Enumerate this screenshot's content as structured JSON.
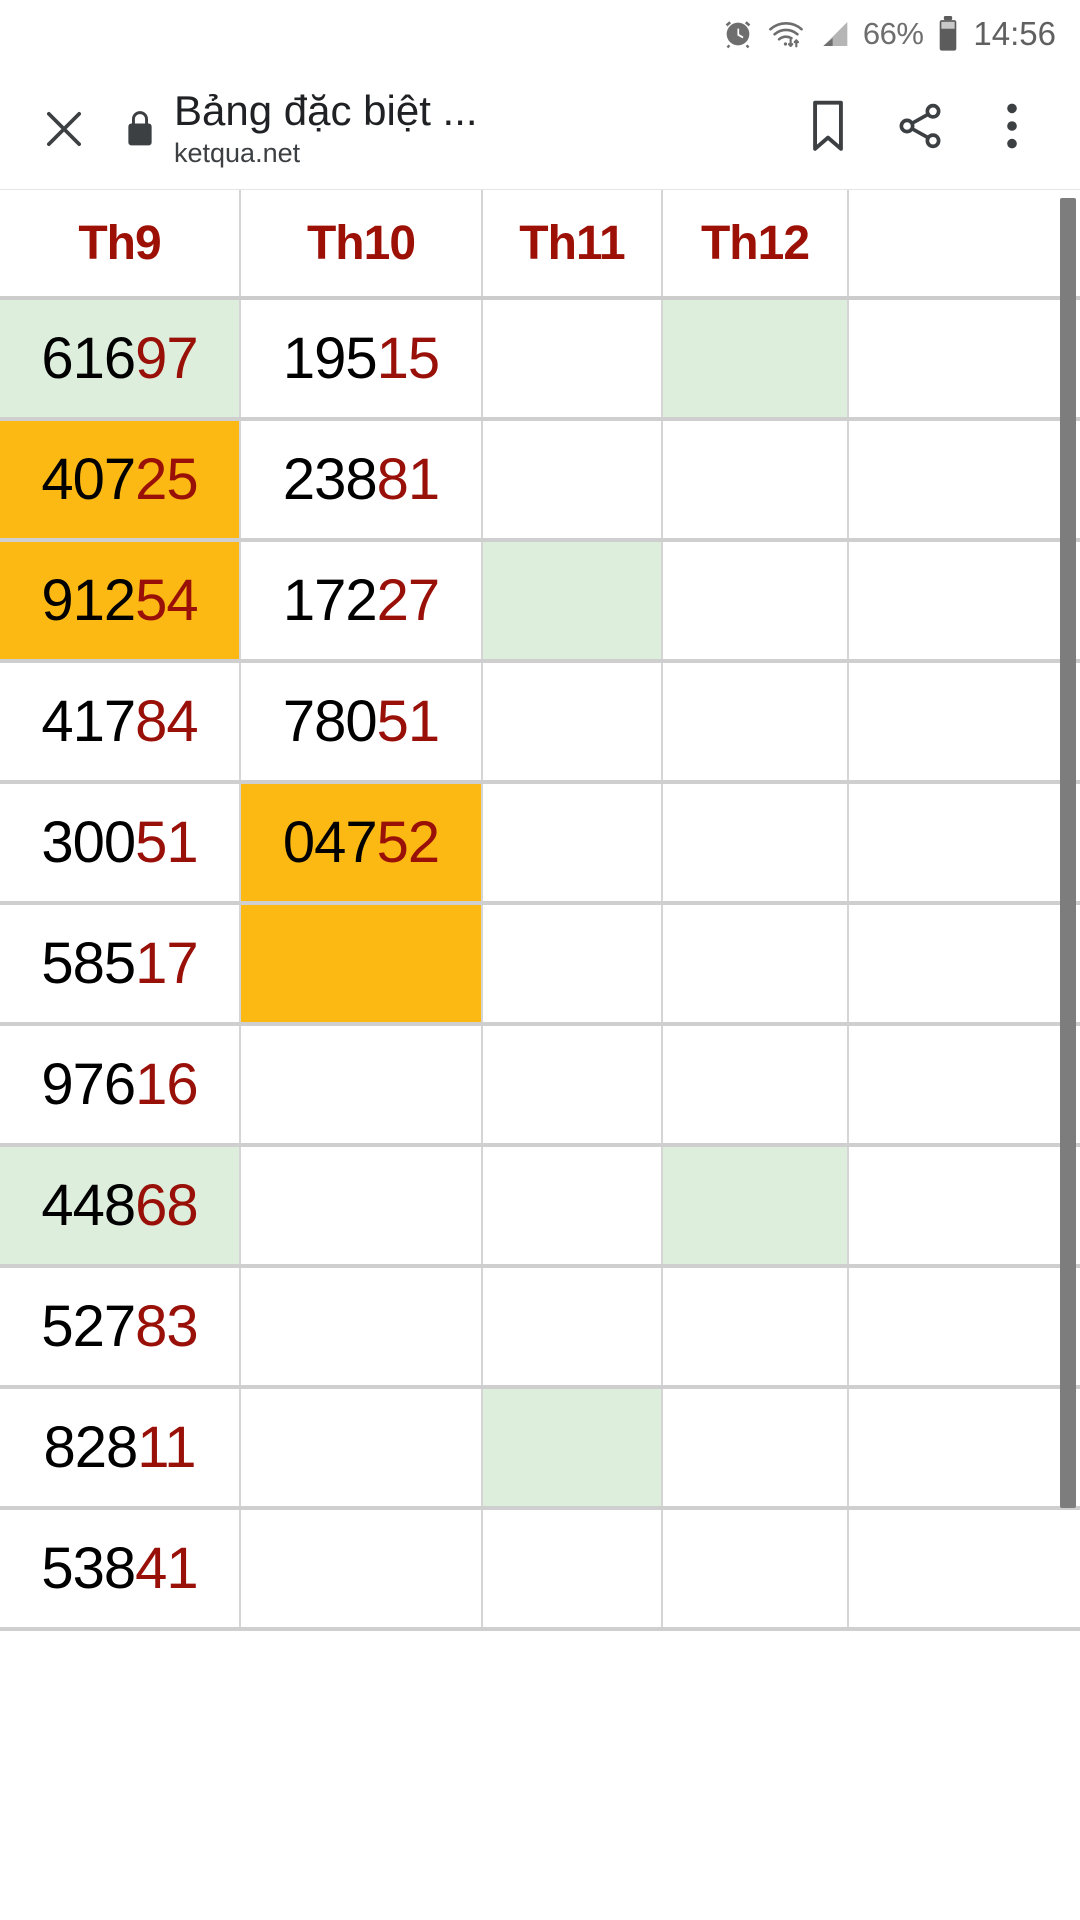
{
  "status_bar": {
    "alarm_icon": "alarm-icon",
    "wifi_icon": "wifi-icon",
    "signal_icon": "cellular-signal-icon",
    "battery_percent": "66%",
    "battery_icon": "battery-icon",
    "clock": "14:56"
  },
  "browser_bar": {
    "close_icon": "close-icon",
    "lock_icon": "lock-icon",
    "title": "Bảng đặc biệt ...",
    "url": "ketqua.net",
    "bookmark_icon": "bookmark-icon",
    "share_icon": "share-icon",
    "overflow_icon": "more-vertical-icon"
  },
  "colors": {
    "header_red": "#9c1006",
    "tail_red": "#991008",
    "highlight_green": "#deeedc",
    "highlight_orange": "#fdb913",
    "grid_line": "#cfcfcf",
    "scrollbar": "#7d7d7d"
  },
  "table": {
    "columns": [
      {
        "label": "Th9"
      },
      {
        "label": "Th10"
      },
      {
        "label": "Th11"
      },
      {
        "label": "Th12"
      },
      {
        "label": ""
      }
    ],
    "rows": [
      {
        "cells": [
          {
            "head": "616",
            "tail": "97",
            "bg": "green"
          },
          {
            "head": "195",
            "tail": "15",
            "bg": "none"
          },
          {
            "head": "",
            "tail": "",
            "bg": "none"
          },
          {
            "head": "",
            "tail": "",
            "bg": "green"
          },
          {
            "head": "",
            "tail": "",
            "bg": "none"
          }
        ]
      },
      {
        "cells": [
          {
            "head": "407",
            "tail": "25",
            "bg": "orange"
          },
          {
            "head": "238",
            "tail": "81",
            "bg": "none"
          },
          {
            "head": "",
            "tail": "",
            "bg": "none"
          },
          {
            "head": "",
            "tail": "",
            "bg": "none"
          },
          {
            "head": "",
            "tail": "",
            "bg": "none"
          }
        ]
      },
      {
        "cells": [
          {
            "head": "912",
            "tail": "54",
            "bg": "orange"
          },
          {
            "head": "172",
            "tail": "27",
            "bg": "none"
          },
          {
            "head": "",
            "tail": "",
            "bg": "green"
          },
          {
            "head": "",
            "tail": "",
            "bg": "none"
          },
          {
            "head": "",
            "tail": "",
            "bg": "none"
          }
        ]
      },
      {
        "cells": [
          {
            "head": "417",
            "tail": "84",
            "bg": "none"
          },
          {
            "head": "780",
            "tail": "51",
            "bg": "none"
          },
          {
            "head": "",
            "tail": "",
            "bg": "none"
          },
          {
            "head": "",
            "tail": "",
            "bg": "none"
          },
          {
            "head": "",
            "tail": "",
            "bg": "none"
          }
        ]
      },
      {
        "cells": [
          {
            "head": "300",
            "tail": "51",
            "bg": "none"
          },
          {
            "head": "047",
            "tail": "52",
            "bg": "orange"
          },
          {
            "head": "",
            "tail": "",
            "bg": "none"
          },
          {
            "head": "",
            "tail": "",
            "bg": "none"
          },
          {
            "head": "",
            "tail": "",
            "bg": "none"
          }
        ]
      },
      {
        "cells": [
          {
            "head": "585",
            "tail": "17",
            "bg": "none"
          },
          {
            "head": "",
            "tail": "",
            "bg": "orange"
          },
          {
            "head": "",
            "tail": "",
            "bg": "none"
          },
          {
            "head": "",
            "tail": "",
            "bg": "none"
          },
          {
            "head": "",
            "tail": "",
            "bg": "none"
          }
        ]
      },
      {
        "cells": [
          {
            "head": "976",
            "tail": "16",
            "bg": "none"
          },
          {
            "head": "",
            "tail": "",
            "bg": "none"
          },
          {
            "head": "",
            "tail": "",
            "bg": "none"
          },
          {
            "head": "",
            "tail": "",
            "bg": "none"
          },
          {
            "head": "",
            "tail": "",
            "bg": "none"
          }
        ]
      },
      {
        "cells": [
          {
            "head": "448",
            "tail": "68",
            "bg": "green"
          },
          {
            "head": "",
            "tail": "",
            "bg": "none"
          },
          {
            "head": "",
            "tail": "",
            "bg": "none"
          },
          {
            "head": "",
            "tail": "",
            "bg": "green"
          },
          {
            "head": "",
            "tail": "",
            "bg": "none"
          }
        ]
      },
      {
        "cells": [
          {
            "head": "527",
            "tail": "83",
            "bg": "none"
          },
          {
            "head": "",
            "tail": "",
            "bg": "none"
          },
          {
            "head": "",
            "tail": "",
            "bg": "none"
          },
          {
            "head": "",
            "tail": "",
            "bg": "none"
          },
          {
            "head": "",
            "tail": "",
            "bg": "none"
          }
        ]
      },
      {
        "cells": [
          {
            "head": "828",
            "tail": "11",
            "bg": "none"
          },
          {
            "head": "",
            "tail": "",
            "bg": "none"
          },
          {
            "head": "",
            "tail": "",
            "bg": "green"
          },
          {
            "head": "",
            "tail": "",
            "bg": "none"
          },
          {
            "head": "",
            "tail": "",
            "bg": "none"
          }
        ]
      },
      {
        "cells": [
          {
            "head": "538",
            "tail": "41",
            "bg": "none"
          },
          {
            "head": "",
            "tail": "",
            "bg": "none"
          },
          {
            "head": "",
            "tail": "",
            "bg": "none"
          },
          {
            "head": "",
            "tail": "",
            "bg": "none"
          },
          {
            "head": "",
            "tail": "",
            "bg": "none"
          }
        ]
      }
    ]
  }
}
